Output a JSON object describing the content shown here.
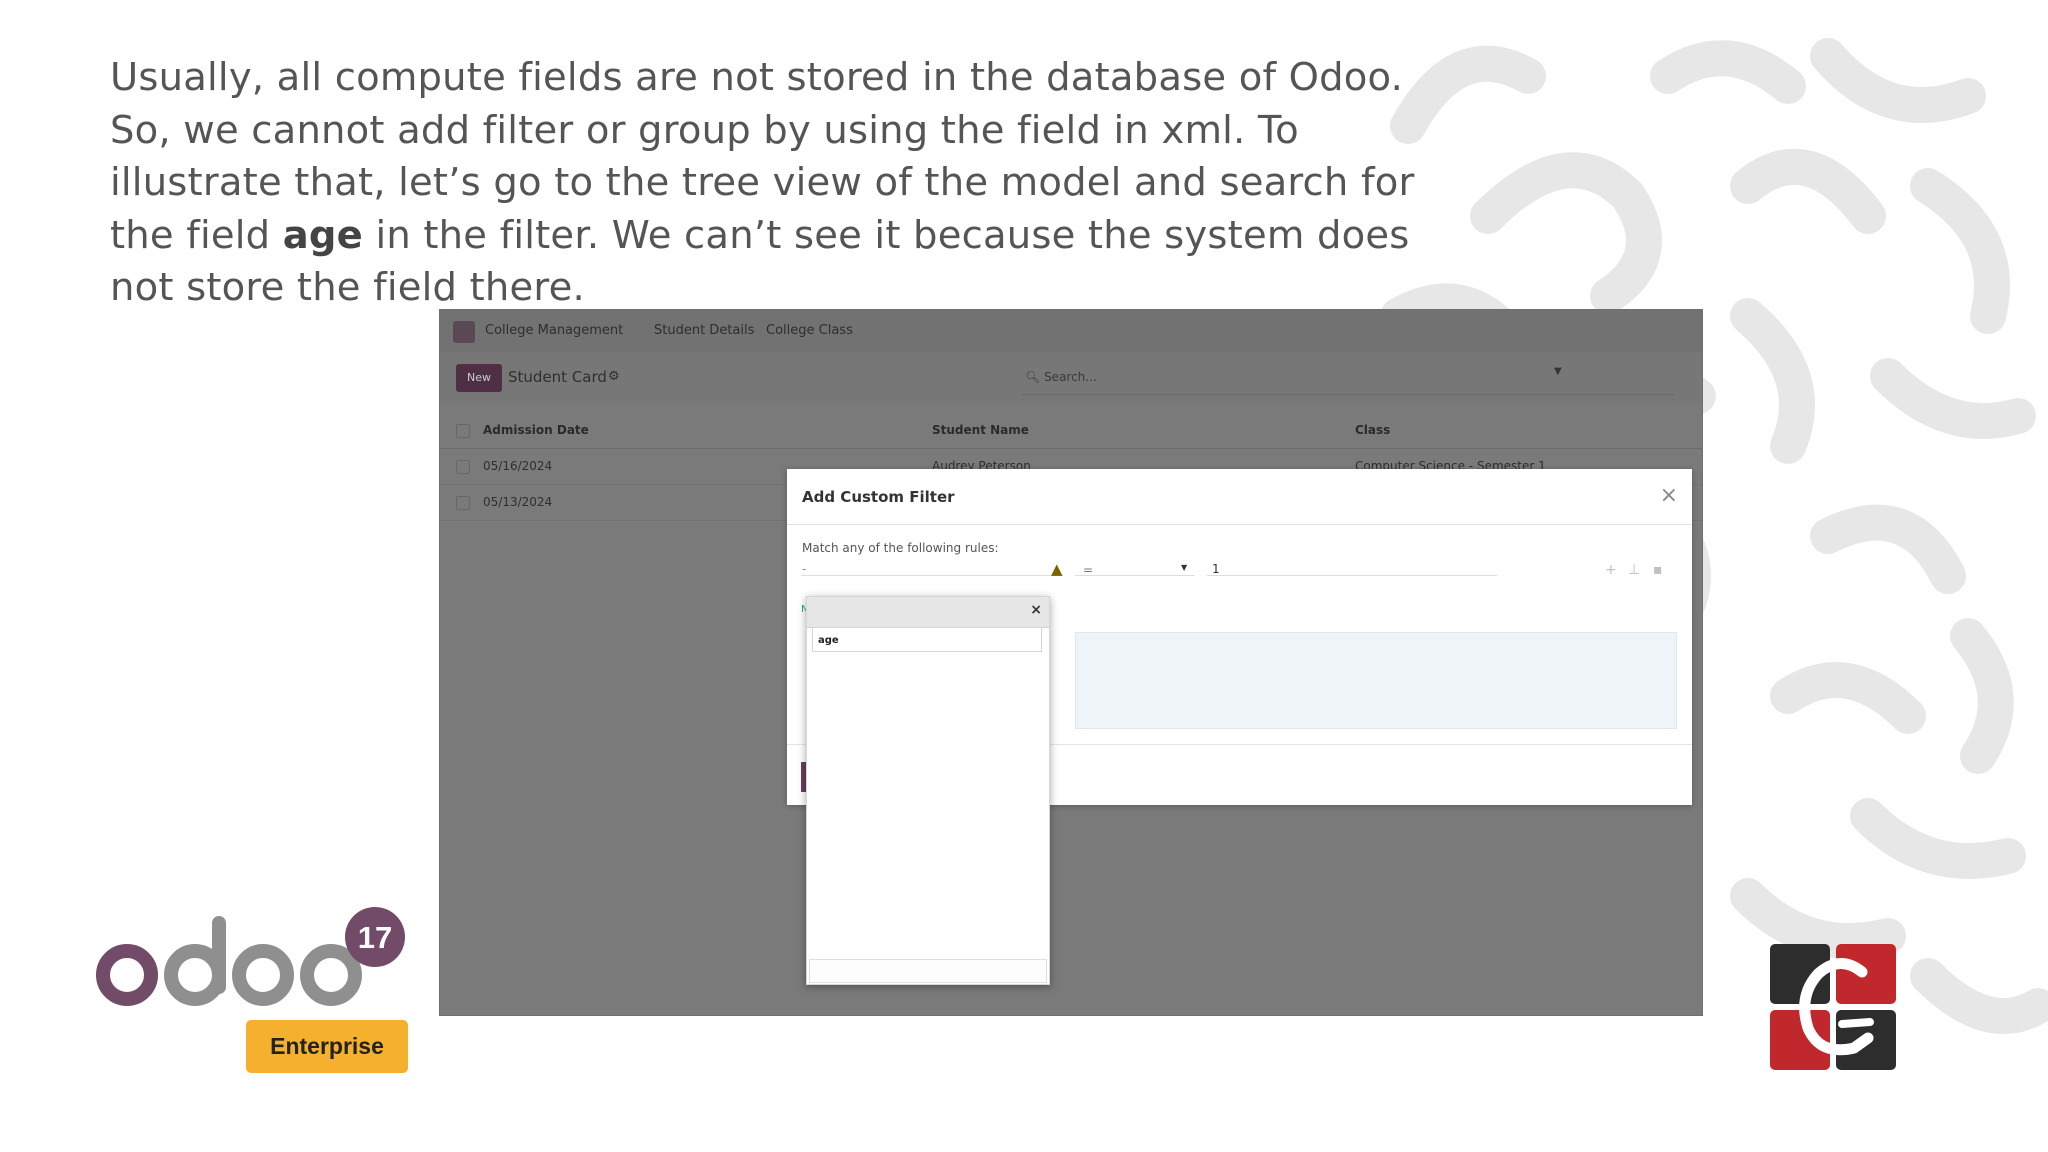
{
  "slide": {
    "lines": [
      {
        "before": "Usually, all compute fields are not stored  in the database of Odoo.",
        "bold": "",
        "after": ""
      },
      {
        "before": "So, we cannot add filter or group by using the field in xml. To",
        "bold": "",
        "after": ""
      },
      {
        "before": "illustrate that, let’s go to the tree view of the model and search for",
        "bold": "",
        "after": ""
      },
      {
        "before": "the field ",
        "bold": "age",
        "after": " in the filter. We can’t see it because the system does"
      },
      {
        "before": "not store the field there.",
        "bold": "",
        "after": ""
      }
    ]
  },
  "app": {
    "nav": [
      "College Management",
      "Student Details",
      "College Class"
    ],
    "new_button": "New",
    "view_title": "Student Card",
    "search_placeholder": "Search...",
    "columns": [
      "Admission Date",
      "Student Name",
      "Class"
    ],
    "rows": [
      {
        "date": "05/16/2024",
        "name": "Audrey Peterson",
        "class": "Computer Science - Semester 1"
      },
      {
        "date": "05/13/2024",
        "name": "",
        "class": ""
      }
    ]
  },
  "modal": {
    "title": "Add Custom Filter",
    "subtitle": "Match any of the following rules:",
    "rule_field": "-",
    "rule_operator": "=",
    "rule_value": "1",
    "code_text": ""
  },
  "picker": {
    "search_value": "age"
  },
  "logos": {
    "odoo_text": "odoo",
    "version": "17",
    "edition": "Enterprise"
  },
  "colors": {
    "odoo_purple": "#714B67",
    "odoo_grey": "#8F8F8F",
    "enterprise_badge": "#F5B12E",
    "brand_red": "#C0282D"
  }
}
